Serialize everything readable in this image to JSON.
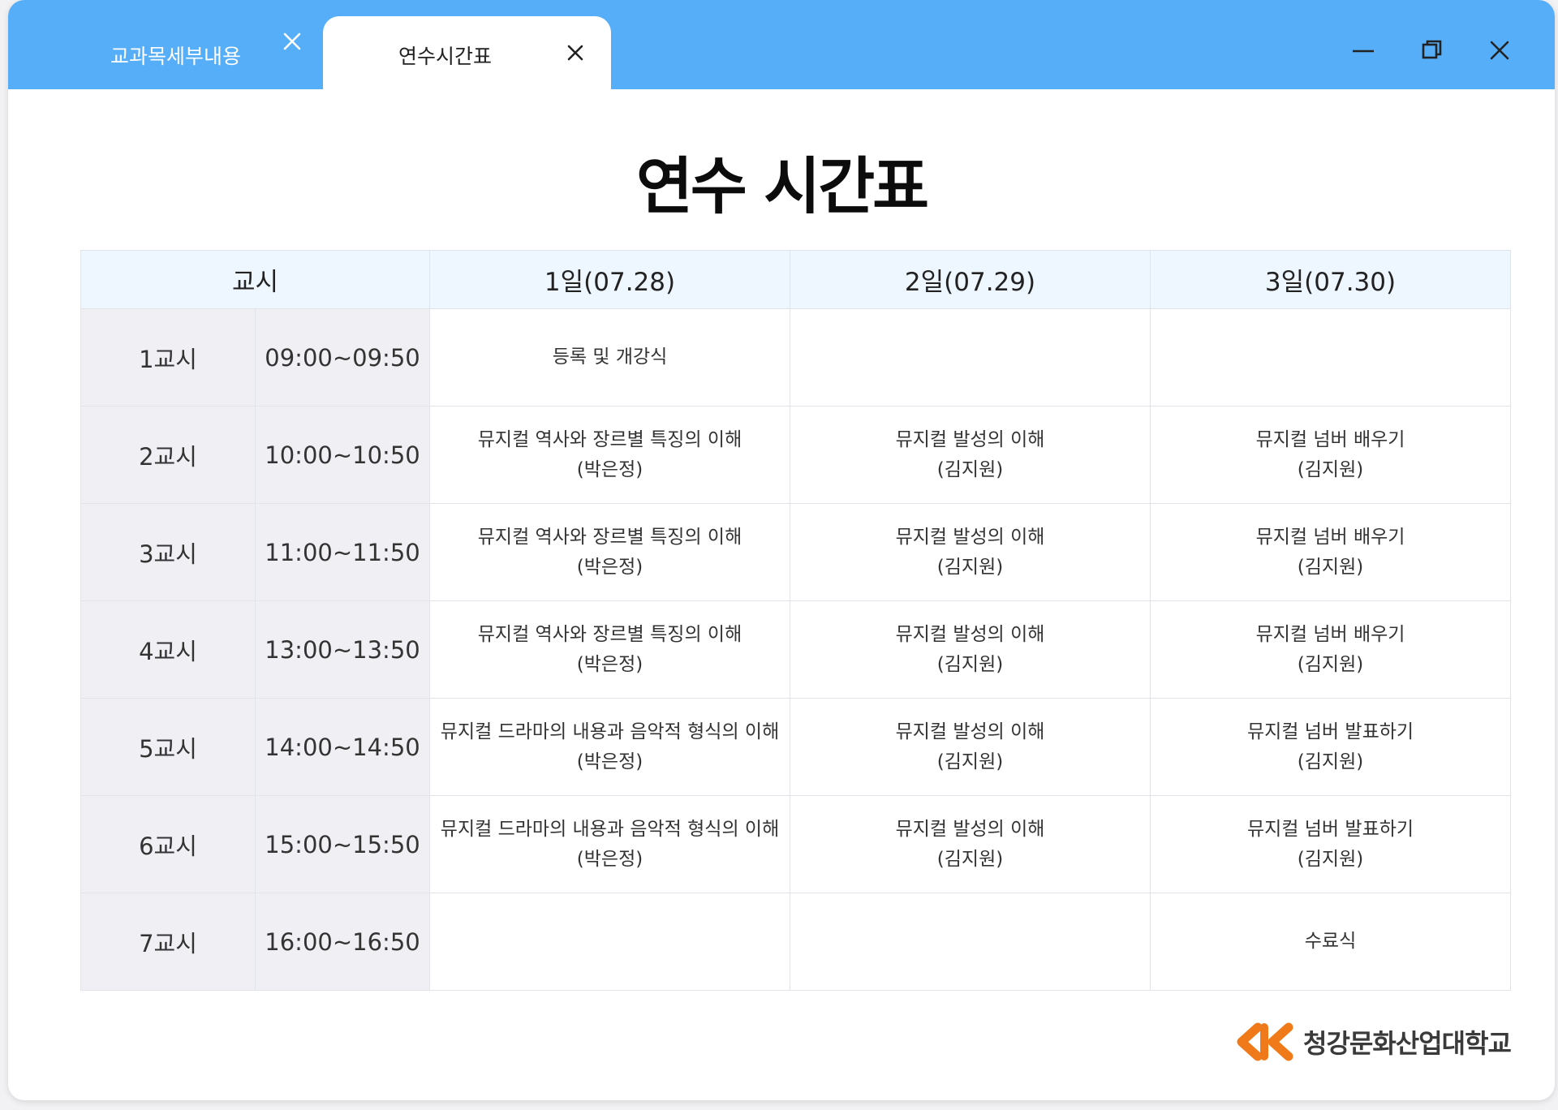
{
  "tabs": [
    {
      "label": "교과목세부내용",
      "active": false
    },
    {
      "label": "연수시간표",
      "active": true
    }
  ],
  "window_controls": [
    "minimize-icon",
    "restore-icon",
    "close-icon"
  ],
  "colors": {
    "titlebar": "#57aef8",
    "header_row": "#eef6ff",
    "period_cells": "#f0eff3",
    "logo_orange": "#f07a1a"
  },
  "page_title": "연수 시간표",
  "table": {
    "header": {
      "period": "교시",
      "days": [
        "1일(07.28)",
        "2일(07.29)",
        "3일(07.30)"
      ]
    },
    "rows": [
      {
        "period": "1교시",
        "time": "09:00~09:50",
        "sessions": [
          [
            "등록 및 개강식"
          ],
          [],
          []
        ]
      },
      {
        "period": "2교시",
        "time": "10:00~10:50",
        "sessions": [
          [
            "뮤지컬 역사와 장르별 특징의 이해",
            "(박은정)"
          ],
          [
            "뮤지컬 발성의 이해",
            "(김지원)"
          ],
          [
            "뮤지컬 넘버 배우기",
            "(김지원)"
          ]
        ]
      },
      {
        "period": "3교시",
        "time": "11:00~11:50",
        "sessions": [
          [
            "뮤지컬 역사와 장르별 특징의 이해",
            "(박은정)"
          ],
          [
            "뮤지컬 발성의 이해",
            "(김지원)"
          ],
          [
            "뮤지컬 넘버 배우기",
            "(김지원)"
          ]
        ]
      },
      {
        "period": "4교시",
        "time": "13:00~13:50",
        "sessions": [
          [
            "뮤지컬 역사와 장르별 특징의 이해",
            "(박은정)"
          ],
          [
            "뮤지컬 발성의 이해",
            "(김지원)"
          ],
          [
            "뮤지컬 넘버 배우기",
            "(김지원)"
          ]
        ]
      },
      {
        "period": "5교시",
        "time": "14:00~14:50",
        "sessions": [
          [
            "뮤지컬 드라마의 내용과 음악적 형식의 이해",
            "(박은정)"
          ],
          [
            "뮤지컬 발성의 이해",
            "(김지원)"
          ],
          [
            "뮤지컬 넘버 발표하기",
            "(김지원)"
          ]
        ]
      },
      {
        "period": "6교시",
        "time": "15:00~15:50",
        "sessions": [
          [
            "뮤지컬 드라마의 내용과 음악적 형식의 이해",
            "(박은정)"
          ],
          [
            "뮤지컬 발성의 이해",
            "(김지원)"
          ],
          [
            "뮤지컬 넘버 발표하기",
            "(김지원)"
          ]
        ]
      },
      {
        "period": "7교시",
        "time": "16:00~16:50",
        "sessions": [
          [],
          [],
          [
            "수료식"
          ]
        ]
      }
    ]
  },
  "logo": {
    "text": "청강문화산업대학교"
  }
}
